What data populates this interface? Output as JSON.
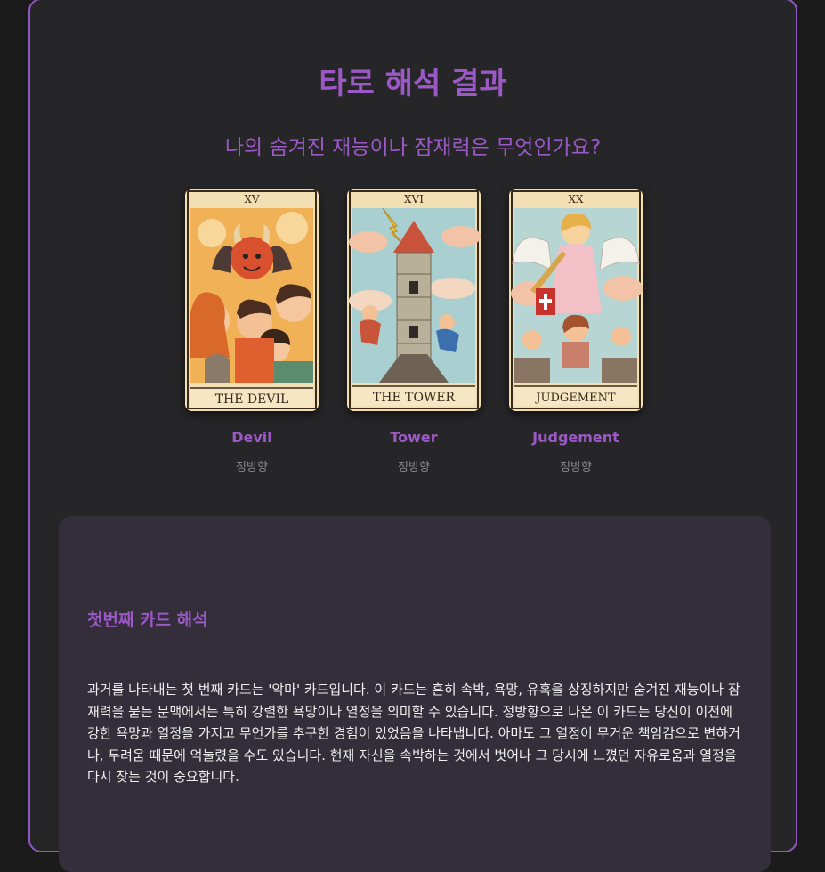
{
  "page": {
    "title": "타로 해석 결과",
    "question": "나의 숨겨진 재능이나 잠재력은 무엇인가요?"
  },
  "cards": [
    {
      "numeral": "XV",
      "banner": "THE DEVIL",
      "name": "Devil",
      "orientation": "정방향"
    },
    {
      "numeral": "XVI",
      "banner": "THE TOWER",
      "name": "Tower",
      "orientation": "정방향"
    },
    {
      "numeral": "XX",
      "banner": "JUDGEMENT",
      "name": "Judgement",
      "orientation": "정방향"
    }
  ],
  "reading": {
    "heading": "첫번째 카드 해석",
    "body": "과거를 나타내는 첫 번째 카드는 '악마' 카드입니다. 이 카드는 흔히 속박, 욕망, 유혹을 상징하지만 숨겨진 재능이나 잠재력을 묻는 문맥에서는 특히 강렬한 욕망이나 열정을 의미할 수 있습니다. 정방향으로 나온 이 카드는 당신이 이전에 강한 욕망과 열정을 가지고 무언가를 추구한 경험이 있었음을 나타냅니다. 아마도 그 열정이 무거운 책임감으로 변하거나, 두려움 때문에 억눌렸을 수도 있습니다. 현재 자신을 속박하는 것에서 벗어나 그 당시에 느꼈던 자유로움과 열정을 다시 찾는 것이 중요합니다."
  },
  "colors": {
    "accent": "#9b59c5",
    "panel": "#262527",
    "reading_bg": "#332e3a",
    "page_bg": "#1b1b1b"
  }
}
